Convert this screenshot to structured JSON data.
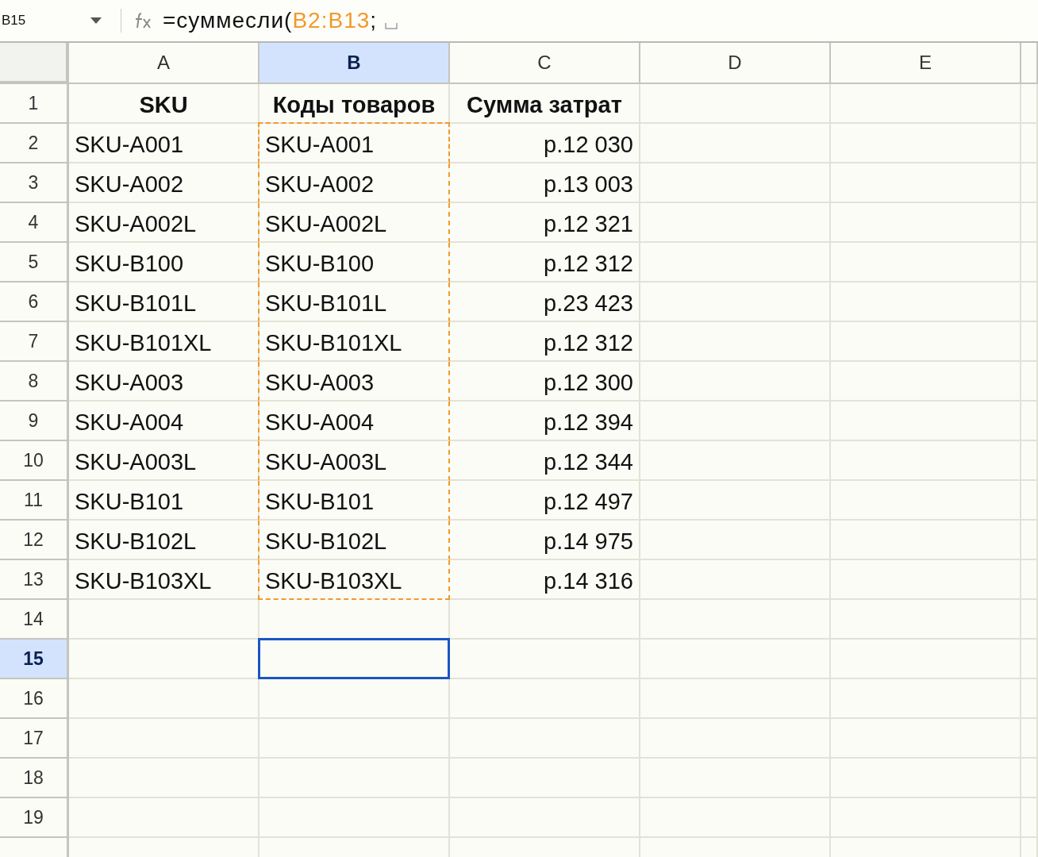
{
  "name_box": "B15",
  "formula": [
    {
      "kind": "text",
      "text": "=суммесли("
    },
    {
      "kind": "range",
      "text": "B2:B13"
    },
    {
      "kind": "text",
      "text": ";"
    }
  ],
  "columns": [
    {
      "label": "A",
      "selected": false
    },
    {
      "label": "B",
      "selected": true
    },
    {
      "label": "C",
      "selected": false
    },
    {
      "label": "D",
      "selected": false
    },
    {
      "label": "E",
      "selected": false
    }
  ],
  "rows": [
    {
      "label": "1",
      "selected": false,
      "cells": [
        {
          "kind": "header",
          "text": "SKU",
          "in_range": false
        },
        {
          "kind": "header",
          "text": "Коды товаров",
          "in_range": false
        },
        {
          "kind": "header",
          "text": "Сумма затрат",
          "in_range": false
        }
      ]
    },
    {
      "label": "2",
      "selected": false,
      "cells": [
        {
          "kind": "text",
          "text": "SKU-A001",
          "in_range": false
        },
        {
          "kind": "text",
          "text": "SKU-A001",
          "in_range": true
        },
        {
          "kind": "number",
          "text": "р.12 030",
          "in_range": false
        }
      ]
    },
    {
      "label": "3",
      "selected": false,
      "cells": [
        {
          "kind": "text",
          "text": "SKU-A002",
          "in_range": false
        },
        {
          "kind": "text",
          "text": "SKU-A002",
          "in_range": true
        },
        {
          "kind": "number",
          "text": "р.13 003",
          "in_range": false
        }
      ]
    },
    {
      "label": "4",
      "selected": false,
      "cells": [
        {
          "kind": "text",
          "text": "SKU-A002L",
          "in_range": false
        },
        {
          "kind": "text",
          "text": "SKU-A002L",
          "in_range": true
        },
        {
          "kind": "number",
          "text": "р.12 321",
          "in_range": false
        }
      ]
    },
    {
      "label": "5",
      "selected": false,
      "cells": [
        {
          "kind": "text",
          "text": "SKU-B100",
          "in_range": false
        },
        {
          "kind": "text",
          "text": "SKU-B100",
          "in_range": true
        },
        {
          "kind": "number",
          "text": "р.12 312",
          "in_range": false
        }
      ]
    },
    {
      "label": "6",
      "selected": false,
      "cells": [
        {
          "kind": "text",
          "text": "SKU-B101L",
          "in_range": false
        },
        {
          "kind": "text",
          "text": "SKU-B101L",
          "in_range": true
        },
        {
          "kind": "number",
          "text": "р.23 423",
          "in_range": false
        }
      ]
    },
    {
      "label": "7",
      "selected": false,
      "cells": [
        {
          "kind": "text",
          "text": "SKU-B101XL",
          "in_range": false
        },
        {
          "kind": "text",
          "text": "SKU-B101XL",
          "in_range": true
        },
        {
          "kind": "number",
          "text": "р.12 312",
          "in_range": false
        }
      ]
    },
    {
      "label": "8",
      "selected": false,
      "cells": [
        {
          "kind": "text",
          "text": "SKU-A003",
          "in_range": false
        },
        {
          "kind": "text",
          "text": "SKU-A003",
          "in_range": true
        },
        {
          "kind": "number",
          "text": "р.12 300",
          "in_range": false
        }
      ]
    },
    {
      "label": "9",
      "selected": false,
      "cells": [
        {
          "kind": "text",
          "text": "SKU-A004",
          "in_range": false
        },
        {
          "kind": "text",
          "text": "SKU-A004",
          "in_range": true
        },
        {
          "kind": "number",
          "text": "р.12 394",
          "in_range": false
        }
      ]
    },
    {
      "label": "10",
      "selected": false,
      "cells": [
        {
          "kind": "text",
          "text": "SKU-A003L",
          "in_range": false
        },
        {
          "kind": "text",
          "text": "SKU-A003L",
          "in_range": true
        },
        {
          "kind": "number",
          "text": "р.12 344",
          "in_range": false
        }
      ]
    },
    {
      "label": "11",
      "selected": false,
      "cells": [
        {
          "kind": "text",
          "text": "SKU-B101",
          "in_range": false
        },
        {
          "kind": "text",
          "text": "SKU-B101",
          "in_range": true
        },
        {
          "kind": "number",
          "text": "р.12 497",
          "in_range": false
        }
      ]
    },
    {
      "label": "12",
      "selected": false,
      "cells": [
        {
          "kind": "text",
          "text": "SKU-B102L",
          "in_range": false
        },
        {
          "kind": "text",
          "text": "SKU-B102L",
          "in_range": true
        },
        {
          "kind": "number",
          "text": "р.14 975",
          "in_range": false
        }
      ]
    },
    {
      "label": "13",
      "selected": false,
      "cells": [
        {
          "kind": "text",
          "text": "SKU-B103XL",
          "in_range": false
        },
        {
          "kind": "text",
          "text": "SKU-B103XL",
          "in_range": true
        },
        {
          "kind": "number",
          "text": "р.14 316",
          "in_range": false
        }
      ]
    },
    {
      "label": "14",
      "selected": false
    },
    {
      "label": "15",
      "selected": true
    },
    {
      "label": "16",
      "selected": false
    },
    {
      "label": "17",
      "selected": false
    },
    {
      "label": "18",
      "selected": false
    },
    {
      "label": "19",
      "selected": false
    }
  ]
}
